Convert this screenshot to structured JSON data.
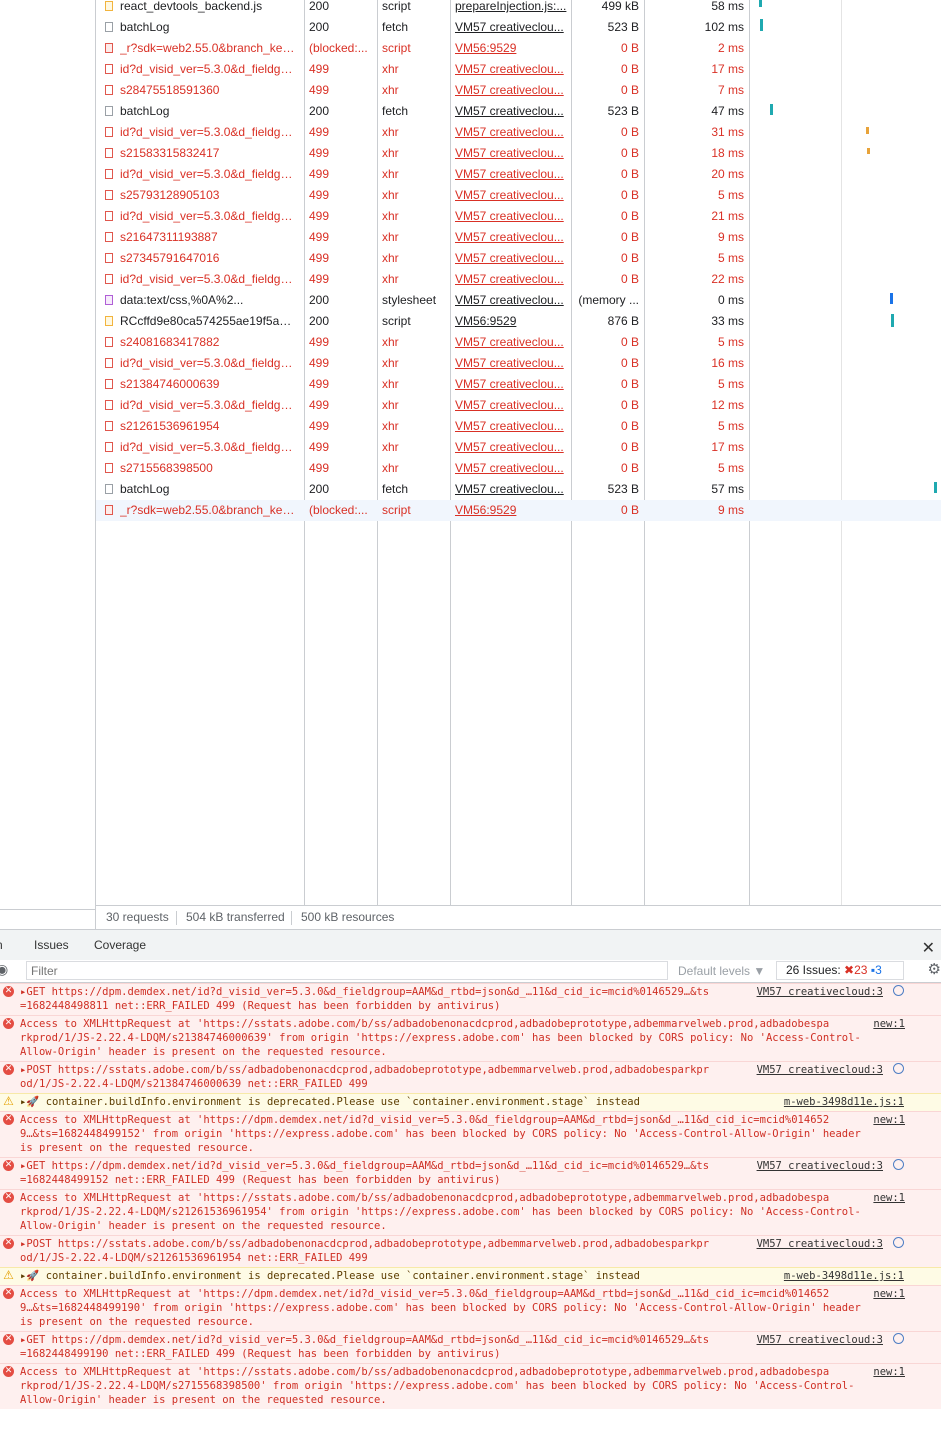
{
  "network": {
    "rows": [
      {
        "name": "react_devtools_backend.js",
        "status": "200",
        "type": "script",
        "initiator": "prepareInjection.js:...",
        "size": "499 kB",
        "time": "58 ms",
        "icon": "script",
        "error": false
      },
      {
        "name": "batchLog",
        "status": "200",
        "type": "fetch",
        "initiator": "VM57 creativeclou...",
        "size": "523 B",
        "time": "102 ms",
        "icon": "doc",
        "error": false
      },
      {
        "name": "_r?sdk=web2.55.0&branch_key...",
        "status": "(blocked:...",
        "type": "script",
        "initiator": "VM56:9529",
        "size": "0 B",
        "time": "2 ms",
        "icon": "script-err",
        "error": true
      },
      {
        "name": "id?d_visid_ver=5.3.0&d_fieldgro...",
        "status": "499",
        "type": "xhr",
        "initiator": "VM57 creativeclou...",
        "size": "0 B",
        "time": "17 ms",
        "icon": "err",
        "error": true
      },
      {
        "name": "s28475518591360",
        "status": "499",
        "type": "xhr",
        "initiator": "VM57 creativeclou...",
        "size": "0 B",
        "time": "7 ms",
        "icon": "err",
        "error": true
      },
      {
        "name": "batchLog",
        "status": "200",
        "type": "fetch",
        "initiator": "VM57 creativeclou...",
        "size": "523 B",
        "time": "47 ms",
        "icon": "doc",
        "error": false
      },
      {
        "name": "id?d_visid_ver=5.3.0&d_fieldgro...",
        "status": "499",
        "type": "xhr",
        "initiator": "VM57 creativeclou...",
        "size": "0 B",
        "time": "31 ms",
        "icon": "err",
        "error": true
      },
      {
        "name": "s21583315832417",
        "status": "499",
        "type": "xhr",
        "initiator": "VM57 creativeclou...",
        "size": "0 B",
        "time": "18 ms",
        "icon": "err",
        "error": true
      },
      {
        "name": "id?d_visid_ver=5.3.0&d_fieldgro...",
        "status": "499",
        "type": "xhr",
        "initiator": "VM57 creativeclou...",
        "size": "0 B",
        "time": "20 ms",
        "icon": "err",
        "error": true
      },
      {
        "name": "s25793128905103",
        "status": "499",
        "type": "xhr",
        "initiator": "VM57 creativeclou...",
        "size": "0 B",
        "time": "5 ms",
        "icon": "err",
        "error": true
      },
      {
        "name": "id?d_visid_ver=5.3.0&d_fieldgro...",
        "status": "499",
        "type": "xhr",
        "initiator": "VM57 creativeclou...",
        "size": "0 B",
        "time": "21 ms",
        "icon": "err",
        "error": true
      },
      {
        "name": "s21647311193887",
        "status": "499",
        "type": "xhr",
        "initiator": "VM57 creativeclou...",
        "size": "0 B",
        "time": "9 ms",
        "icon": "err",
        "error": true
      },
      {
        "name": "s27345791647016",
        "status": "499",
        "type": "xhr",
        "initiator": "VM57 creativeclou...",
        "size": "0 B",
        "time": "5 ms",
        "icon": "err",
        "error": true
      },
      {
        "name": "id?d_visid_ver=5.3.0&d_fieldgro...",
        "status": "499",
        "type": "xhr",
        "initiator": "VM57 creativeclou...",
        "size": "0 B",
        "time": "22 ms",
        "icon": "err",
        "error": true
      },
      {
        "name": "data:text/css,%0A%2...",
        "status": "200",
        "type": "stylesheet",
        "initiator": "VM57 creativeclou...",
        "size": "(memory ...",
        "time": "0 ms",
        "icon": "css",
        "error": false
      },
      {
        "name": "RCcffd9e80ca574255ae19f5aac0...",
        "status": "200",
        "type": "script",
        "initiator": "VM56:9529",
        "size": "876 B",
        "time": "33 ms",
        "icon": "script",
        "error": false
      },
      {
        "name": "s24081683417882",
        "status": "499",
        "type": "xhr",
        "initiator": "VM57 creativeclou...",
        "size": "0 B",
        "time": "5 ms",
        "icon": "err",
        "error": true
      },
      {
        "name": "id?d_visid_ver=5.3.0&d_fieldgro...",
        "status": "499",
        "type": "xhr",
        "initiator": "VM57 creativeclou...",
        "size": "0 B",
        "time": "16 ms",
        "icon": "err",
        "error": true
      },
      {
        "name": "s21384746000639",
        "status": "499",
        "type": "xhr",
        "initiator": "VM57 creativeclou...",
        "size": "0 B",
        "time": "5 ms",
        "icon": "err",
        "error": true
      },
      {
        "name": "id?d_visid_ver=5.3.0&d_fieldgro...",
        "status": "499",
        "type": "xhr",
        "initiator": "VM57 creativeclou...",
        "size": "0 B",
        "time": "12 ms",
        "icon": "err",
        "error": true
      },
      {
        "name": "s21261536961954",
        "status": "499",
        "type": "xhr",
        "initiator": "VM57 creativeclou...",
        "size": "0 B",
        "time": "5 ms",
        "icon": "err",
        "error": true
      },
      {
        "name": "id?d_visid_ver=5.3.0&d_fieldgro...",
        "status": "499",
        "type": "xhr",
        "initiator": "VM57 creativeclou...",
        "size": "0 B",
        "time": "17 ms",
        "icon": "err",
        "error": true
      },
      {
        "name": "s2715568398500",
        "status": "499",
        "type": "xhr",
        "initiator": "VM57 creativeclou...",
        "size": "0 B",
        "time": "5 ms",
        "icon": "err",
        "error": true
      },
      {
        "name": "batchLog",
        "status": "200",
        "type": "fetch",
        "initiator": "VM57 creativeclou...",
        "size": "523 B",
        "time": "57 ms",
        "icon": "doc",
        "error": false
      },
      {
        "name": "_r?sdk=web2.55.0&branch_key...",
        "status": "(blocked:...",
        "type": "script",
        "initiator": "VM56:9529",
        "size": "0 B",
        "time": "9 ms",
        "icon": "script-err",
        "error": true
      }
    ],
    "summary": {
      "requests": "30 requests",
      "transferred": "504 kB transferred",
      "resources": "500 kB resources"
    }
  },
  "drawer": {
    "tabs": [
      "Issues",
      "Coverage"
    ],
    "close_icon": "close-icon"
  },
  "console": {
    "filter_placeholder": "Filter",
    "levels": "Default levels ▼",
    "issues_label": "26 Issues:",
    "issues_errors": "23",
    "issues_info": "3",
    "messages": [
      {
        "kind": "error",
        "lines": [
          "▸GET https://dpm.demdex.net/id?d_visid_ver=5.3.0&d_fieldgroup=AAM&d_rtbd=json&d_…11&d_cid_ic=mcid%0146529…&ts",
          "=1682448498811 net::ERR_FAILED 499 (Request has been forbidden by antivirus)"
        ],
        "source": "VM57 creativecloud:3",
        "globe": true
      },
      {
        "kind": "error",
        "lines": [
          "Access to XMLHttpRequest at 'https://sstats.adobe.com/b/ss/adbadobenonacdcprod,adbadobeprototype,adbemmarvelweb.prod,adbadobespa",
          "rkprod/1/JS-2.22.4-LDQM/s21384746000639' from origin 'https://express.adobe.com' has been blocked by CORS policy: No 'Access-Control-",
          "Allow-Origin' header is present on the requested resource."
        ],
        "source": "new:1",
        "globe": false
      },
      {
        "kind": "error",
        "lines": [
          "▸POST https://sstats.adobe.com/b/ss/adbadobenonacdcprod,adbadobeprototype,adbemmarvelweb.prod,adbadobesparkpr",
          "od/1/JS-2.22.4-LDQM/s21384746000639 net::ERR_FAILED 499"
        ],
        "source": "VM57 creativecloud:3",
        "globe": true
      },
      {
        "kind": "warn",
        "lines": [
          "▸🚀 container.buildInfo.environment is deprecated.Please use `container.environment.stage` instead"
        ],
        "source": "m-web-3498d11e.js:1",
        "globe": false
      },
      {
        "kind": "error",
        "lines": [
          "Access to XMLHttpRequest at 'https://dpm.demdex.net/id?d_visid_ver=5.3.0&d_fieldgroup=AAM&d_rtbd=json&d_…11&d_cid_ic=mcid%014652",
          "9…&ts=1682448499152' from origin 'https://express.adobe.com' has been blocked by CORS policy: No 'Access-Control-Allow-Origin' header",
          "is present on the requested resource."
        ],
        "source": "new:1",
        "globe": false
      },
      {
        "kind": "error",
        "lines": [
          "▸GET https://dpm.demdex.net/id?d_visid_ver=5.3.0&d_fieldgroup=AAM&d_rtbd=json&d_…11&d_cid_ic=mcid%0146529…&ts",
          "=1682448499152 net::ERR_FAILED 499 (Request has been forbidden by antivirus)"
        ],
        "source": "VM57 creativecloud:3",
        "globe": true
      },
      {
        "kind": "error",
        "lines": [
          "Access to XMLHttpRequest at 'https://sstats.adobe.com/b/ss/adbadobenonacdcprod,adbadobeprototype,adbemmarvelweb.prod,adbadobespa",
          "rkprod/1/JS-2.22.4-LDQM/s21261536961954' from origin 'https://express.adobe.com' has been blocked by CORS policy: No 'Access-Control-",
          "Allow-Origin' header is present on the requested resource."
        ],
        "source": "new:1",
        "globe": false
      },
      {
        "kind": "error",
        "lines": [
          "▸POST https://sstats.adobe.com/b/ss/adbadobenonacdcprod,adbadobeprototype,adbemmarvelweb.prod,adbadobesparkpr",
          "od/1/JS-2.22.4-LDQM/s21261536961954 net::ERR_FAILED 499"
        ],
        "source": "VM57 creativecloud:3",
        "globe": true
      },
      {
        "kind": "warn",
        "lines": [
          "▸🚀 container.buildInfo.environment is deprecated.Please use `container.environment.stage` instead"
        ],
        "source": "m-web-3498d11e.js:1",
        "globe": false
      },
      {
        "kind": "error",
        "lines": [
          "Access to XMLHttpRequest at 'https://dpm.demdex.net/id?d_visid_ver=5.3.0&d_fieldgroup=AAM&d_rtbd=json&d_…11&d_cid_ic=mcid%014652",
          "9…&ts=1682448499190' from origin 'https://express.adobe.com' has been blocked by CORS policy: No 'Access-Control-Allow-Origin' header",
          "is present on the requested resource."
        ],
        "source": "new:1",
        "globe": false
      },
      {
        "kind": "error",
        "lines": [
          "▸GET https://dpm.demdex.net/id?d_visid_ver=5.3.0&d_fieldgroup=AAM&d_rtbd=json&d_…11&d_cid_ic=mcid%0146529…&ts",
          "=1682448499190 net::ERR_FAILED 499 (Request has been forbidden by antivirus)"
        ],
        "source": "VM57 creativecloud:3",
        "globe": true
      },
      {
        "kind": "error",
        "lines": [
          "Access to XMLHttpRequest at 'https://sstats.adobe.com/b/ss/adbadobenonacdcprod,adbadobeprototype,adbemmarvelweb.prod,adbadobespa",
          "rkprod/1/JS-2.22.4-LDQM/s2715568398500' from origin 'https://express.adobe.com' has been blocked by CORS policy: No 'Access-Control-",
          "Allow-Origin' header is present on the requested resource."
        ],
        "source": "new:1",
        "globe": false
      }
    ]
  },
  "colors": {
    "error_text": "#d93025",
    "error_bg": "#fef0ef",
    "warn_bg": "#fefbe5",
    "accent": "#1a73e8",
    "waterfall_teal": "#1fa9b0"
  }
}
